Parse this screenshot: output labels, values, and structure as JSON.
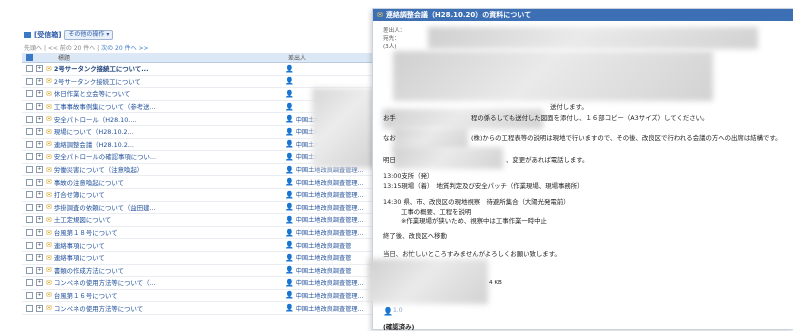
{
  "inbox": {
    "title": "[受信箱]",
    "ops_button": "その他の操作 ▾",
    "pager_first": "先頭へ",
    "pager_prev": "| << 前の 20 件へ |",
    "pager_next": "次の 20 件へ >>",
    "col_subject": "標題",
    "col_sender": "差出人",
    "rows": [
      {
        "subject": "2号サータンク接続工について...",
        "sender": "",
        "unread": true
      },
      {
        "subject": "2号サータンク接続工について",
        "sender": "",
        "unread": false
      },
      {
        "subject": "休日作業と立会等について",
        "sender": "",
        "unread": false
      },
      {
        "subject": "工事事故事例集について（参考送...",
        "sender": "",
        "unread": false
      },
      {
        "subject": "安全パトロール（H28.10....",
        "sender": "中国土地改良調査管理...",
        "unread": false
      },
      {
        "subject": "現場について（H28.10.2...",
        "sender": "中国土地改良調査管理...",
        "unread": false
      },
      {
        "subject": "連絡調整会議（H28.10.2...",
        "sender": "中国土地改良調査管理...",
        "unread": false
      },
      {
        "subject": "安全パトロールの確認事項につい...",
        "sender": "中国土地改良調査管理...",
        "unread": false
      },
      {
        "subject": "労働災害について（注意喚起）",
        "sender": "中国土地改良調査管理...",
        "unread": false
      },
      {
        "subject": "事故の注意喚起について",
        "sender": "中国土地改良調査管理...",
        "unread": false
      },
      {
        "subject": "打合せ簿について",
        "sender": "中国土地改良調査管理...",
        "unread": false
      },
      {
        "subject": "歩掛調査の依頼について（益田建...",
        "sender": "中国土地改良調査管理...",
        "unread": false
      },
      {
        "subject": "土工定規図について",
        "sender": "中国土地改良調査管理...",
        "unread": false
      },
      {
        "subject": "台風第１８号について",
        "sender": "中国土地改良調査管理...",
        "unread": false
      },
      {
        "subject": "連絡事項について",
        "sender": "中国土地改良調査管",
        "unread": false
      },
      {
        "subject": "連絡事項について",
        "sender": "中国土地改良調査管",
        "unread": false
      },
      {
        "subject": "書類の作成方法について",
        "sender": "中国土地改良調査管",
        "unread": false
      },
      {
        "subject": "コンペネの使用方法等について（...",
        "sender": "中国土地改良調査管理...",
        "unread": false
      },
      {
        "subject": "台風第１６号について",
        "sender": "中国土地改良調査管理...",
        "unread": false
      },
      {
        "subject": "コンペネの使用方法等について",
        "sender": "中国土地改良調査管理...",
        "unread": false
      }
    ]
  },
  "detail": {
    "title": "連絡調整会議（H28.10.20）の資料について",
    "meta_from": "差出人：",
    "meta_to": "宛先：",
    "meta_count": "(3人)",
    "body": {
      "line1": "送付します。",
      "line2a": "お手",
      "line2b": "程の係るしても送付した図面を添付し、１６部コピー（A3サイズ）してください。",
      "line3a": "なお",
      "line3b": "(株)からの工程表等の説明は現地で行いますので、その後、改良区で行われる会議の方への出席は結構です。",
      "line4a": "明日",
      "line4b": "、変更があれば電話します。",
      "sch1": "13:00支所（発）",
      "sch2": "13:15現場（着）　地質判定及び安全パッチ（作業現場、現場事務所）",
      "sch3": "14:30 県、市、改良区の現地視察　待避所集合（大陽光発電前）",
      "sch3a": "工事の概要、工程を説明",
      "sch3b": "※作業現場が狭いため、視察中は工事作業一時中止",
      "sch4": "終了後、改良区へ移動",
      "closing": "当日、お忙しいところすみませんがよろしくお願い致します。",
      "attach_size": "4 KB",
      "attach_label": "1.0",
      "footer": "(確認済み)"
    }
  }
}
